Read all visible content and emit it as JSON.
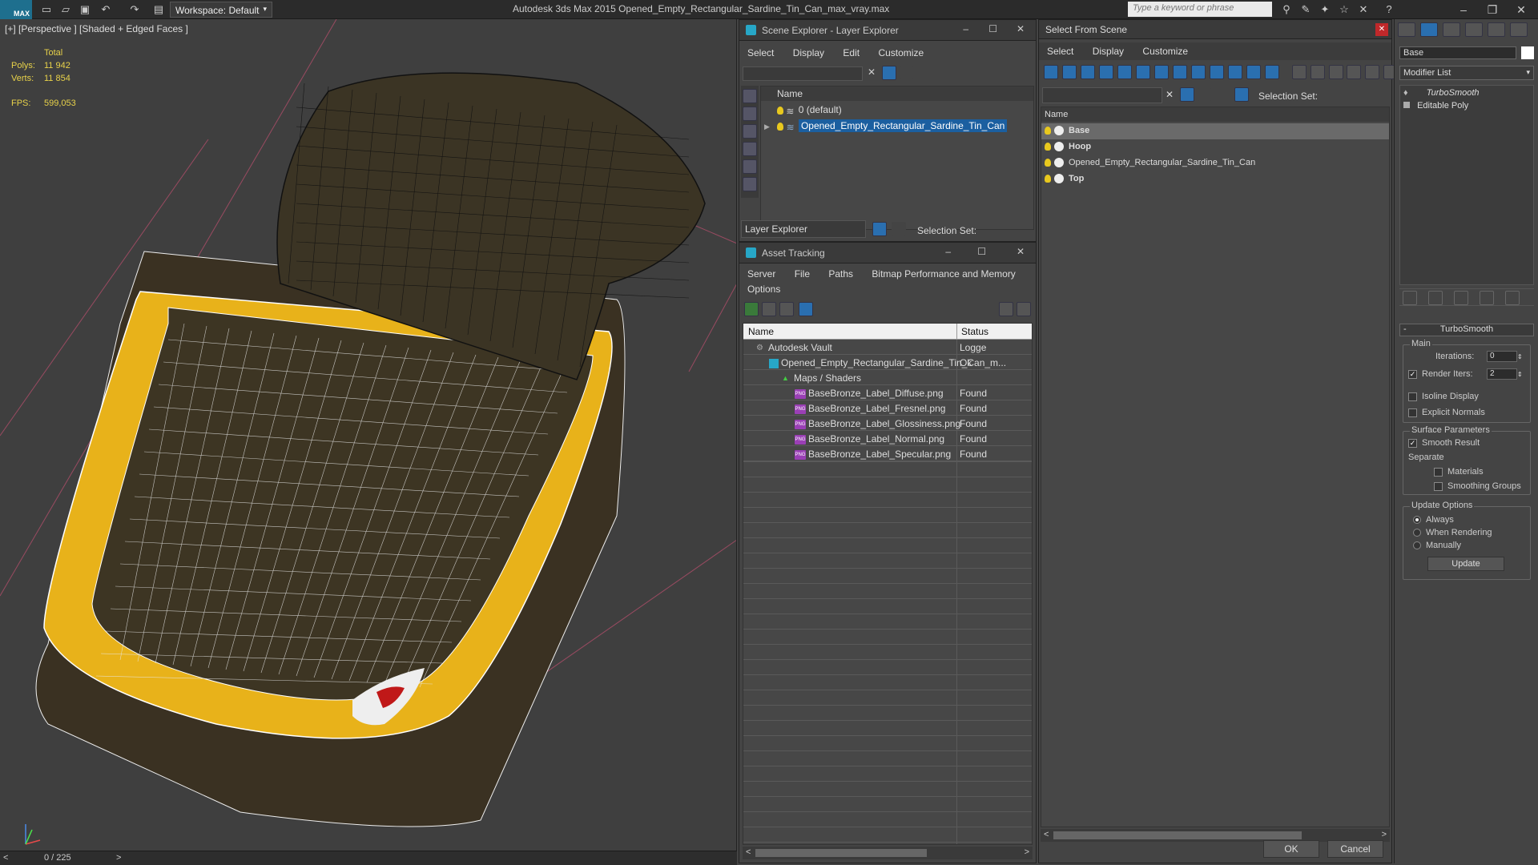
{
  "app": {
    "title": "Autodesk 3ds Max  2015     Opened_Empty_Rectangular_Sardine_Tin_Can_max_vray.max",
    "logo_text": "MAX",
    "workspace": "Workspace: Default",
    "search_placeholder": "Type a keyword or phrase"
  },
  "viewport": {
    "label": "[+] [Perspective ] [Shaded + Edged Faces ]",
    "total_label": "Total",
    "polys_label": "Polys:",
    "polys_value": "11 942",
    "verts_label": "Verts:",
    "verts_value": "11 854",
    "fps_label": "FPS:",
    "fps_value": "599,053",
    "frame_counter": "0 / 225"
  },
  "scene_explorer": {
    "title": "Scene Explorer - Layer Explorer",
    "menu": [
      "Select",
      "Display",
      "Edit",
      "Customize"
    ],
    "name_header": "Name",
    "layers": [
      {
        "name": "0 (default)",
        "selected": false
      },
      {
        "name": "Opened_Empty_Rectangular_Sardine_Tin_Can",
        "selected": true
      }
    ],
    "explorer_select": "Layer Explorer",
    "selection_set_label": "Selection Set:"
  },
  "asset_tracking": {
    "title": "Asset Tracking",
    "menu": [
      "Server",
      "File",
      "Paths",
      "Bitmap Performance and Memory"
    ],
    "menu2": [
      "Options"
    ],
    "col_name": "Name",
    "col_status": "Status",
    "rows": [
      {
        "name": "Autodesk Vault",
        "status": "Logge",
        "indent": 1,
        "icon": "vault"
      },
      {
        "name": "Opened_Empty_Rectangular_Sardine_Tin_Can_m...",
        "status": "Ok",
        "indent": 2,
        "icon": "max"
      },
      {
        "name": "Maps / Shaders",
        "status": "",
        "indent": 3,
        "icon": "maps"
      },
      {
        "name": "BaseBronze_Label_Diffuse.png",
        "status": "Found",
        "indent": 4,
        "icon": "png"
      },
      {
        "name": "BaseBronze_Label_Fresnel.png",
        "status": "Found",
        "indent": 4,
        "icon": "png"
      },
      {
        "name": "BaseBronze_Label_Glossiness.png",
        "status": "Found",
        "indent": 4,
        "icon": "png"
      },
      {
        "name": "BaseBronze_Label_Normal.png",
        "status": "Found",
        "indent": 4,
        "icon": "png"
      },
      {
        "name": "BaseBronze_Label_Specular.png",
        "status": "Found",
        "indent": 4,
        "icon": "png"
      }
    ]
  },
  "select_from_scene": {
    "title": "Select From Scene",
    "menu": [
      "Select",
      "Display",
      "Customize"
    ],
    "selection_set_label": "Selection Set:",
    "name_header": "Name",
    "objects": [
      {
        "name": "Base",
        "selected": true,
        "bold": true
      },
      {
        "name": "Hoop",
        "selected": false,
        "bold": true
      },
      {
        "name": "Opened_Empty_Rectangular_Sardine_Tin_Can",
        "selected": false,
        "bold": false
      },
      {
        "name": "Top",
        "selected": false,
        "bold": true
      }
    ],
    "ok_label": "OK",
    "cancel_label": "Cancel"
  },
  "command_panel": {
    "object_name": "Base",
    "modifier_list": "Modifier List",
    "stack": [
      "TurboSmooth",
      "Editable Poly"
    ],
    "rollout_title": "TurboSmooth",
    "main_label": "Main",
    "iterations_label": "Iterations:",
    "iterations_value": "0",
    "render_iters_label": "Render Iters:",
    "render_iters_value": "2",
    "isoline_label": "Isoline Display",
    "explicit_label": "Explicit Normals",
    "surface_label": "Surface Parameters",
    "smooth_result_label": "Smooth Result",
    "separate_label": "Separate",
    "materials_label": "Materials",
    "smoothing_groups_label": "Smoothing Groups",
    "update_options_label": "Update Options",
    "always_label": "Always",
    "when_rendering_label": "When Rendering",
    "manually_label": "Manually",
    "update_button": "Update",
    "collapse_mark": "-"
  },
  "colors": {
    "accent": "#1b5fa0",
    "stat_yellow": "#e8d24a",
    "tin_yellow": "#e8b21a",
    "tin_dark": "#3a3020"
  }
}
